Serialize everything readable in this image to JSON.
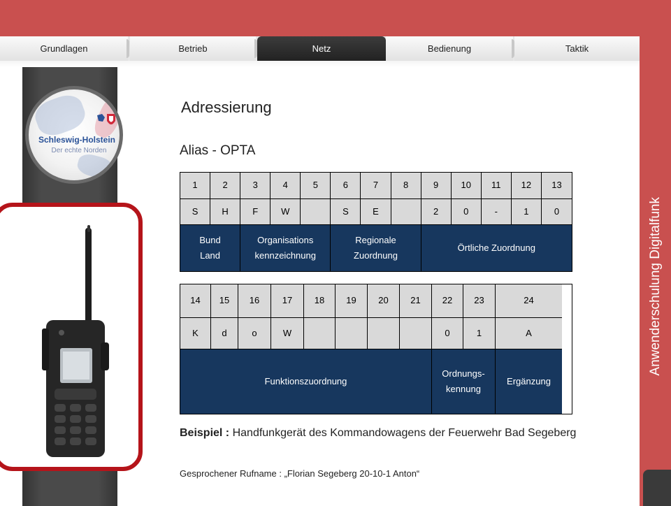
{
  "tabs": [
    {
      "label": "Grundlagen",
      "active": false
    },
    {
      "label": "Betrieb",
      "active": false
    },
    {
      "label": "Netz",
      "active": true
    },
    {
      "label": "Bedienung",
      "active": false
    },
    {
      "label": "Taktik",
      "active": false
    }
  ],
  "logo": {
    "line1": "Schleswig-Holstein",
    "line2": "Der echte Norden"
  },
  "side_title": "Anwenderschulung Digitalfunk",
  "heading": "Adressierung",
  "subheading": "Alias - OPTA",
  "table1": {
    "numbers": [
      "1",
      "2",
      "3",
      "4",
      "5",
      "6",
      "7",
      "8",
      "9",
      "10",
      "11",
      "12",
      "13"
    ],
    "letters": [
      "S",
      "H",
      "F",
      "W",
      "",
      "S",
      "E",
      "",
      "2",
      "0",
      "-",
      "1",
      "0"
    ],
    "groups": [
      {
        "label": "Bund\nLand",
        "span": 2
      },
      {
        "label": "Organisations\nkennzeichnung",
        "span": 3
      },
      {
        "label": "Regionale\nZuordnung",
        "span": 3
      },
      {
        "label": "Örtliche Zuordnung",
        "span": 5
      }
    ]
  },
  "table2": {
    "numbers": [
      "14",
      "15",
      "16",
      "17",
      "18",
      "19",
      "20",
      "21",
      "22",
      "23",
      "24"
    ],
    "letters": [
      "K",
      "d",
      "o",
      "W",
      "",
      "",
      "",
      "",
      "0",
      "1",
      "A"
    ],
    "groups": [
      {
        "label": "Funktionszuordnung",
        "span": 8
      },
      {
        "label": "Ordnungs-\nkennung",
        "span": 2
      },
      {
        "label": "Ergänzung",
        "span": 1
      }
    ]
  },
  "example": {
    "label": "Beispiel :",
    "text": " Handfunkgerät des Kommandowagens der Feuerwehr Bad Segeberg"
  },
  "spoken": "Gesprochener Rufname : „Florian Segeberg 20-10-1 Anton“",
  "colors": {
    "background_red": "#c9504f",
    "navy": "#17375e",
    "cell_gray": "#d9d9d9",
    "frame_red": "#b5141a"
  }
}
